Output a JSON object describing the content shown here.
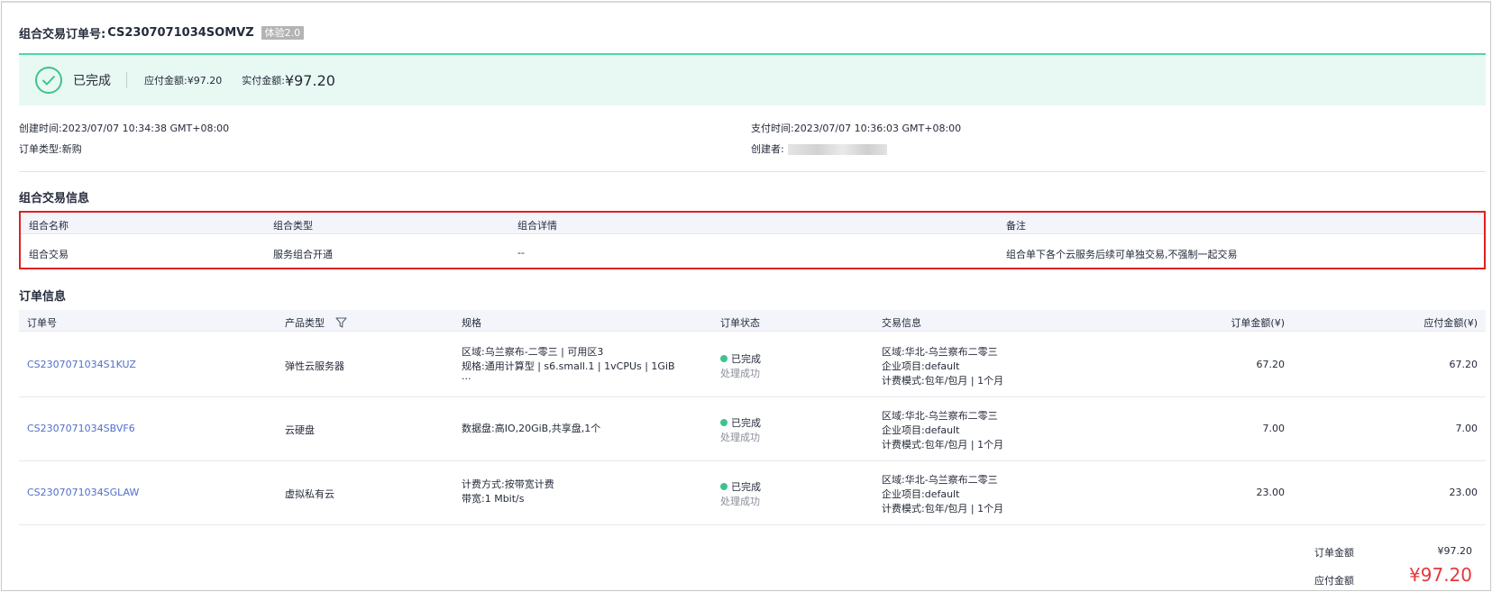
{
  "header": {
    "title_label": "组合交易订单号:",
    "order_no": "CS2307071034SOMVZ",
    "badge": "体验2.0"
  },
  "status": {
    "text": "已完成",
    "payable_label": "应付金额:",
    "payable_value": "¥97.20",
    "paid_label": "实付金额:",
    "paid_value": "¥97.20",
    "icon": "check-circle-icon",
    "accent": "#3dc48e"
  },
  "meta": {
    "created_time": "创建时间:2023/07/07 10:34:38 GMT+08:00",
    "order_type": "订单类型:新购",
    "pay_time": "支付时间:2023/07/07 10:36:03 GMT+08:00",
    "creator_label": "创建者:"
  },
  "combo": {
    "section_title": "组合交易信息",
    "columns": [
      "组合名称",
      "组合类型",
      "组合详情",
      "备注"
    ],
    "row": [
      "组合交易",
      "服务组合开通",
      "--",
      "组合单下各个云服务后续可单独交易,不强制一起交易"
    ]
  },
  "orders": {
    "section_title": "订单信息",
    "columns": [
      "订单号",
      "产品类型",
      "规格",
      "订单状态",
      "交易信息",
      "订单金额(¥)",
      "应付金额(¥)"
    ],
    "rows": [
      {
        "order_no": "CS2307071034S1KUZ",
        "product": "弹性云服务器",
        "spec": [
          "区域:乌兰察布-二零三 | 可用区3",
          "规格:通用计算型 | s6.small.1 | 1vCPUs | 1GiB",
          "..."
        ],
        "status": "已完成",
        "status_sub": "处理成功",
        "trade": [
          "区域:华北-乌兰察布二零三",
          "企业项目:default",
          "计费模式:包年/包月 | 1个月"
        ],
        "amount": "67.20",
        "payable": "67.20"
      },
      {
        "order_no": "CS2307071034SBVF6",
        "product": "云硬盘",
        "spec": [
          "数据盘:高IO,20GiB,共享盘,1个"
        ],
        "status": "已完成",
        "status_sub": "处理成功",
        "trade": [
          "区域:华北-乌兰察布二零三",
          "企业项目:default",
          "计费模式:包年/包月 | 1个月"
        ],
        "amount": "7.00",
        "payable": "7.00"
      },
      {
        "order_no": "CS2307071034SGLAW",
        "product": "虚拟私有云",
        "spec": [
          "计费方式:按带宽计费",
          "带宽:1 Mbit/s"
        ],
        "status": "已完成",
        "status_sub": "处理成功",
        "trade": [
          "区域:华北-乌兰察布二零三",
          "企业项目:default",
          "计费模式:包年/包月 | 1个月"
        ],
        "amount": "23.00",
        "payable": "23.00"
      }
    ]
  },
  "totals": {
    "order_amount_label": "订单金额",
    "order_amount_value": "¥97.20",
    "payable_label": "应付金额",
    "payable_value": "¥97.20"
  }
}
